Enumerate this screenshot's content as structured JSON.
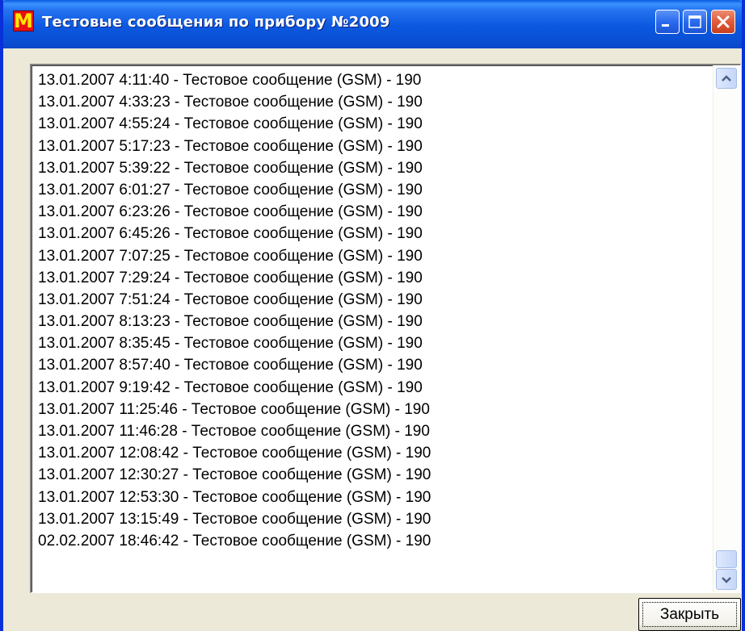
{
  "window": {
    "title": "Тестовые сообщения по прибору №2009",
    "icon_letter": "M",
    "colors": {
      "titlebar": "#0a58e0",
      "frame": "#0831d9",
      "close_button": "#e15a3a",
      "body": "#ece9d8"
    }
  },
  "titlebar_buttons": {
    "minimize": "minimize-icon",
    "maximize": "maximize-icon",
    "close": "close-icon"
  },
  "messages": [
    "13.01.2007 4:11:40 - Тестовое сообщение (GSM) - 190",
    "13.01.2007 4:33:23 - Тестовое сообщение (GSM) - 190",
    "13.01.2007 4:55:24 - Тестовое сообщение (GSM) - 190",
    "13.01.2007 5:17:23 - Тестовое сообщение (GSM) - 190",
    "13.01.2007 5:39:22 - Тестовое сообщение (GSM) - 190",
    "13.01.2007 6:01:27 - Тестовое сообщение (GSM) - 190",
    "13.01.2007 6:23:26 - Тестовое сообщение (GSM) - 190",
    "13.01.2007 6:45:26 - Тестовое сообщение (GSM) - 190",
    "13.01.2007 7:07:25 - Тестовое сообщение (GSM) - 190",
    "13.01.2007 7:29:24 - Тестовое сообщение (GSM) - 190",
    "13.01.2007 7:51:24 - Тестовое сообщение (GSM) - 190",
    "13.01.2007 8:13:23 - Тестовое сообщение (GSM) - 190",
    "13.01.2007 8:35:45 - Тестовое сообщение (GSM) - 190",
    "13.01.2007 8:57:40 - Тестовое сообщение (GSM) - 190",
    "13.01.2007 9:19:42 - Тестовое сообщение (GSM) - 190",
    "13.01.2007 11:25:46 - Тестовое сообщение (GSM) - 190",
    "13.01.2007 11:46:28 - Тестовое сообщение (GSM) - 190",
    "13.01.2007 12:08:42 - Тестовое сообщение (GSM) - 190",
    "13.01.2007 12:30:27 - Тестовое сообщение (GSM) - 190",
    "13.01.2007 12:53:30 - Тестовое сообщение (GSM) - 190",
    "13.01.2007 13:15:49 - Тестовое сообщение (GSM) - 190",
    "02.02.2007 18:46:42 - Тестовое сообщение (GSM) - 190"
  ],
  "scrollbar": {
    "up_icon": "scroll-up-arrow-icon",
    "down_icon": "scroll-down-arrow-icon",
    "position": "bottom"
  },
  "buttons": {
    "close_label": "Закрыть"
  }
}
